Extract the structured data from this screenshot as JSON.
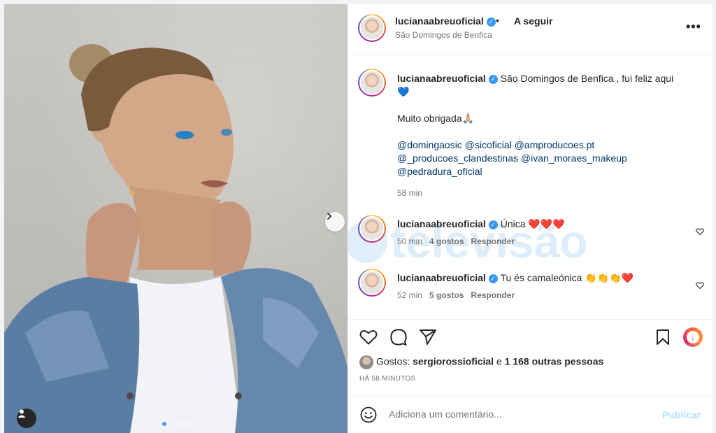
{
  "post": {
    "username": "lucianaabreuoficial",
    "separator": "•",
    "follow_label": "A seguir",
    "location": "São Domingos de Benfica",
    "more_label": "•••"
  },
  "caption": {
    "username": "lucianaabreuoficial",
    "text_line1": "São Domingos de Benfica , fui feliz aqui",
    "emoji_heart": "💙",
    "thanks": "Muito obrigada🙏🏼",
    "mentions_line1": "@domingaosic @sicoficial @amproducoes.pt",
    "mentions_line2": "@_producoes_clandestinas @ivan_moraes_makeup",
    "mentions_line3": "@pedradura_oficial",
    "time": "58 min"
  },
  "comments": [
    {
      "username": "lucianaabreuoficial",
      "text": "Única ❤️❤️❤️",
      "time": "50 min",
      "likes": "4 gostos",
      "reply": "Responder"
    },
    {
      "username": "lucianaabreuoficial",
      "text": "Tu és camaleónica 👏👏👏❤️",
      "time": "52 min",
      "likes": "5 gostos",
      "reply": "Responder"
    }
  ],
  "watermark": "televisão",
  "likes_summary": {
    "prefix": "Gostos:",
    "user": "sergiorossioficial",
    "connector": "e",
    "others": "1 168 outras pessoas"
  },
  "posted_ago": "HÁ 58 MINUTOS",
  "comment_box": {
    "placeholder": "Adiciona um comentário...",
    "publish_label": "Publicar"
  },
  "icons": [
    "heart-icon",
    "comment-icon",
    "share-icon",
    "bookmark-icon",
    "emoji-icon",
    "verified-icon",
    "more-icon",
    "next-icon",
    "user-tag-icon"
  ],
  "colors": {
    "accent_blue": "#3897f0",
    "mention": "#00376b",
    "muted": "#737373",
    "publish_disabled": "#b2dffc"
  }
}
